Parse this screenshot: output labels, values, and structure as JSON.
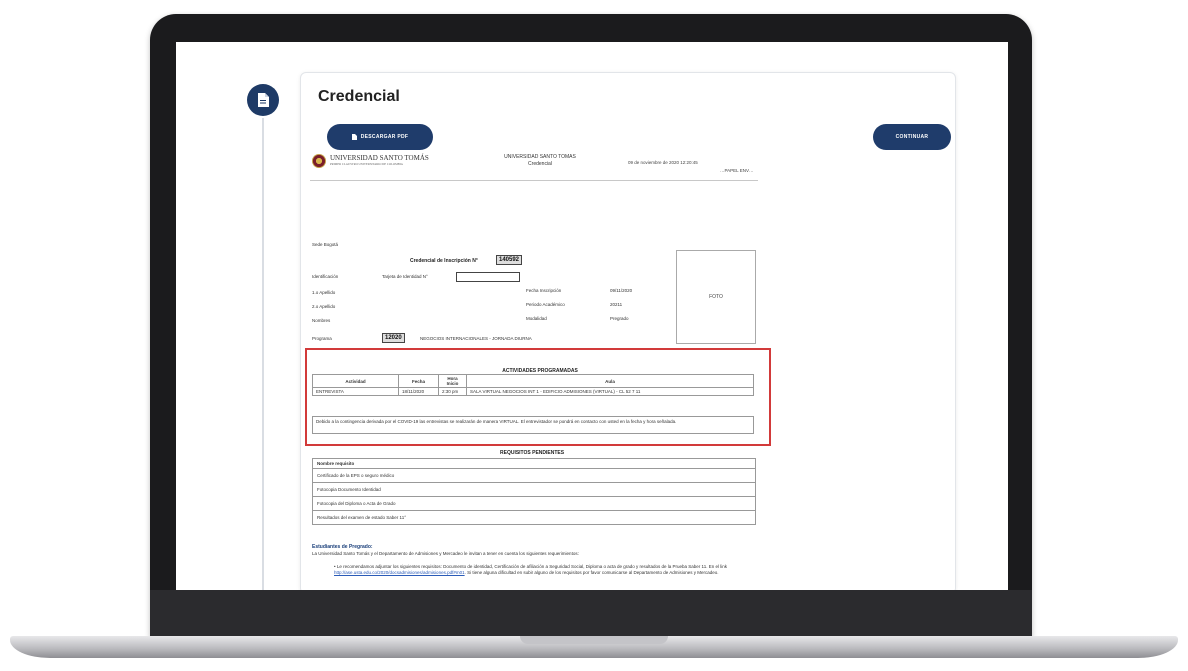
{
  "app": {
    "title": "Credencial"
  },
  "buttons": {
    "pdf": "DESCARGAR PDF",
    "continuar": "CONTINUAR"
  },
  "icons": {
    "side": "document-icon",
    "pdf": "document-icon"
  },
  "colors": {
    "primary": "#1f3c6b",
    "highlight": "#d23a3a"
  },
  "document": {
    "logo_name": "UNIVERSIDAD SANTO TOMÁS",
    "logo_sub": "PRIMER CLAUSTRO UNIVERSITARIO DE COLOMBIA",
    "university": "UNIVERSIDAD SANTO TOMAS",
    "subtitle": "Credencial",
    "date": "09 de noviembre de 2020 12:20:45",
    "cut": "…PAPEL ENV…",
    "sede": "Sede Bogotá",
    "cred_label": "Credencial de Inscripción N°",
    "cred_number": "140592",
    "identificacion_label": "Identificación",
    "id_type": "Tarjeta de Identidad N°",
    "apellido1": "1.o Apellido",
    "apellido2": "2.o Apellido",
    "nombres": "Nombres",
    "programa_label": "Programa",
    "programa_code": "12020",
    "programa_name": "NEGOCIOS INTERNACIONALES - JORNADA DIURNA",
    "fecha_insc_label": "Fecha Inscripción",
    "fecha_insc": "09/11/2020",
    "periodo_label": "Periodo Académico",
    "periodo": "20211",
    "modalidad_label": "Modalidad",
    "modalidad": "Pregrado",
    "foto": "FOTO"
  },
  "activities": {
    "title": "ACTIVIDADES PROGRAMADAS",
    "headers": [
      "Actividad",
      "Fecha",
      "Hora Inicio",
      "Aula"
    ],
    "rows": [
      {
        "actividad": "ENTREVISTA",
        "fecha": "18/11/2020",
        "hora": "2:30 pm",
        "aula": "SALA VIRTUAL NEGOCIOS INT 1 - EDIFICIO ADMISIONES (VIRTUAL) - CL 52 7 11"
      }
    ],
    "note": "Debido a la contingencia derivada por el COVID-19 las entrevistas se realizarán de manera VIRTUAL. El entrevistador se pondrá en contacto con usted en la fecha y hora señalada."
  },
  "requirements": {
    "title": "REQUISITOS PENDIENTES",
    "header": "Nombre requisito",
    "items": [
      "Certificado de la EPS o seguro médico",
      "Fotocopia Documento Identidad",
      "Fotocopia del Diploma o Acta de Grado",
      "Resultados del examen de estado Saber 11°"
    ]
  },
  "pregrado": {
    "title": "Estudiantes de Pregrado:",
    "intro": "La Universidad Santo Tomás y el Departamento de Admisiones y Mercadeo le invitan a tener en cuenta los siguientes requerimientos:",
    "bullet": "Le recomendamos adjuntar los siguientes requisitos: Documento de identidad, Certificación de afiliación a Seguridad Social, Diploma o acta de grado y resultados de la Prueba Saber 11. En el link",
    "link": "http://ase.usta.edu.co/2020/docsadmisiones/admisiones.pdf#m01",
    "bullet_end": ". Si tiene alguna dificultad en subir alguno de los requisitos por favor comunicarse al Departamento de Admisiones y Mercadeo."
  }
}
